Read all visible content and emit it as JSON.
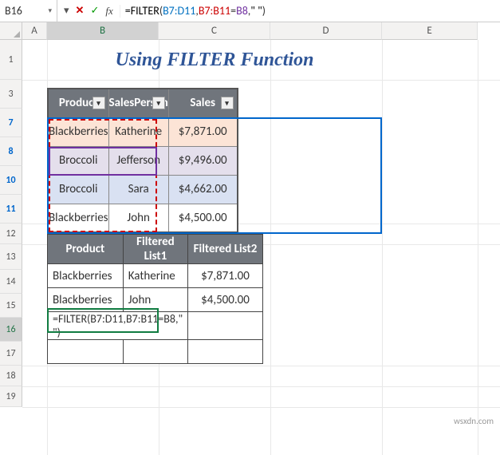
{
  "nameBox": "B16",
  "formulaBar": {
    "raw": "=FILTER(B7:D11,B7:B11=B8,\" \")",
    "parts": {
      "eq": "=",
      "fn": "FILTER",
      "lp": "(",
      "r1": "B7:D11",
      "c1": ",",
      "r2": "B7:B11",
      "eq2": "=",
      "r3": "B8",
      "c2": ",",
      "lit": "\" \"",
      "rp": ")"
    }
  },
  "columns": [
    "A",
    "B",
    "C",
    "D",
    "E"
  ],
  "rows": [
    "1",
    "3",
    "7",
    "8",
    "10",
    "11",
    "12",
    "13",
    "14",
    "15",
    "16",
    "17",
    "18",
    "19"
  ],
  "title": "Using FILTER Function",
  "table1": {
    "headers": [
      "Product",
      "SalesPerson",
      "Sales"
    ],
    "rows": [
      {
        "product": "Blackberries",
        "person": "Katherine",
        "currency": "$",
        "sales": "7,871.00"
      },
      {
        "product": "Broccoli",
        "person": "Jefferson",
        "currency": "$",
        "sales": "9,496.00"
      },
      {
        "product": "Broccoli",
        "person": "Sara",
        "currency": "$",
        "sales": "4,662.00"
      },
      {
        "product": "Blackberries",
        "person": "John",
        "currency": "$",
        "sales": "4,500.00"
      }
    ]
  },
  "table2": {
    "headers": [
      "Product",
      "Filtered List1",
      "Filtered List2"
    ],
    "rows": [
      {
        "product": "Blackberries",
        "list1": "Katherine",
        "currency": "$",
        "list2": "7,871.00"
      },
      {
        "product": "Blackberries",
        "list1": "John",
        "currency": "$",
        "list2": "4,500.00"
      }
    ],
    "formulaDisplay": "=FILTER(B7:D11,B7:B11=B8,\" \")"
  },
  "icons": {
    "dropdown": "▾",
    "cancel": "✕",
    "confirm": "✓",
    "fx": "fx",
    "filter": "▾"
  },
  "watermark": "wsxdn.com",
  "chart_data": {
    "type": "table",
    "title": "Using FILTER Function",
    "source": {
      "columns": [
        "Product",
        "SalesPerson",
        "Sales"
      ],
      "rows": [
        [
          "Blackberries",
          "Katherine",
          7871.0
        ],
        [
          "Broccoli",
          "Jefferson",
          9496.0
        ],
        [
          "Broccoli",
          "Sara",
          4662.0
        ],
        [
          "Blackberries",
          "John",
          4500.0
        ]
      ]
    },
    "filtered": {
      "columns": [
        "Product",
        "Filtered List1",
        "Filtered List2"
      ],
      "rows": [
        [
          "Blackberries",
          "Katherine",
          7871.0
        ],
        [
          "Blackberries",
          "John",
          4500.0
        ]
      ]
    },
    "formula": "=FILTER(B7:D11,B7:B11=B8,\" \")"
  }
}
